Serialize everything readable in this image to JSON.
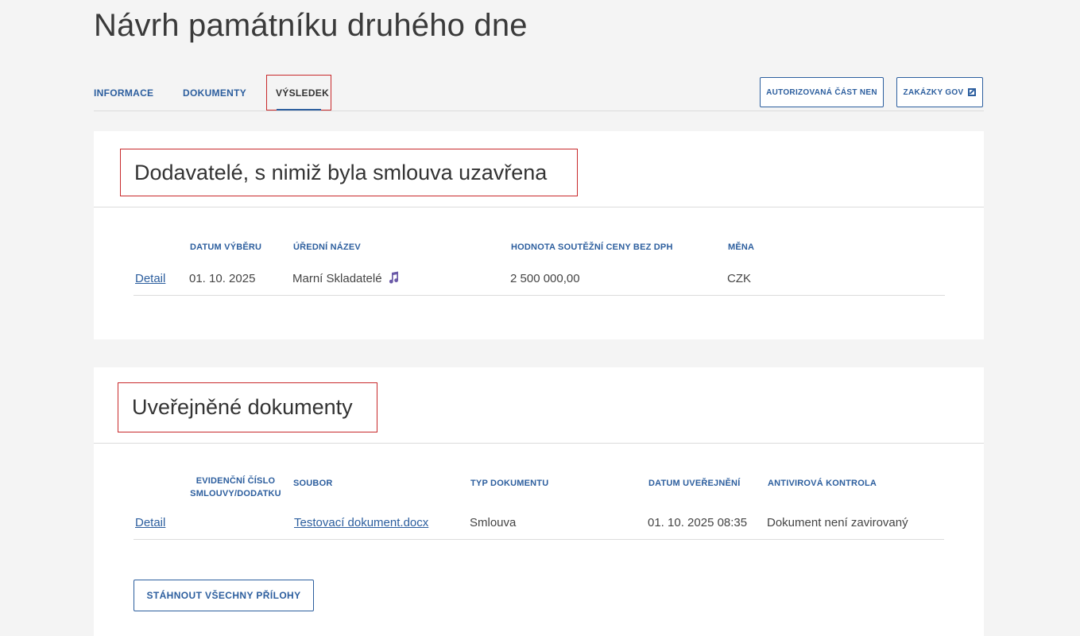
{
  "page": {
    "title": "Návrh památníku druhého dne"
  },
  "tabs": [
    {
      "label": "INFORMACE"
    },
    {
      "label": "DOKUMENTY"
    },
    {
      "label": "VÝSLEDEK"
    }
  ],
  "header_buttons": {
    "autorizovana": "AUTORIZOVANÁ ČÁST NEN",
    "zakazky": "ZAKÁZKY GOV"
  },
  "suppliers": {
    "title": "Dodavatelé, s nimiž byla smlouva uzavřena",
    "columns": [
      "DATUM VÝBĚRU",
      "ÚŘEDNÍ NÁZEV",
      "HODNOTA SOUTĚŽNÍ CENY BEZ DPH",
      "MĚNA"
    ],
    "rows": [
      {
        "detail": "Detail",
        "date": "01. 10. 2025",
        "name": "Marní Skladatelé",
        "value": "2 500 000,00",
        "currency": "CZK",
        "icon": "music-note-icon"
      }
    ]
  },
  "documents": {
    "title": "Uveřejněné dokumenty",
    "columns": [
      "EVIDENČNÍ ČÍSLO SMLOUVY/DODATKU",
      "SOUBOR",
      "TYP DOKUMENTU",
      "DATUM UVEŘEJNĚNÍ",
      "ANTIVIROVÁ KONTROLA"
    ],
    "rows": [
      {
        "detail": "Detail",
        "number": "",
        "file": "Testovací dokument.docx",
        "type": "Smlouva",
        "published": "01. 10. 2025 08:35",
        "antivirus": "Dokument není zavirovaný"
      }
    ],
    "download_label": "STÁHNOUT VŠECHNY PŘÍLOHY"
  },
  "colors": {
    "accent": "#2c5e9e",
    "highlight": "#c8292b",
    "background": "#f4f4f4",
    "icon": "#6b5aa8"
  }
}
